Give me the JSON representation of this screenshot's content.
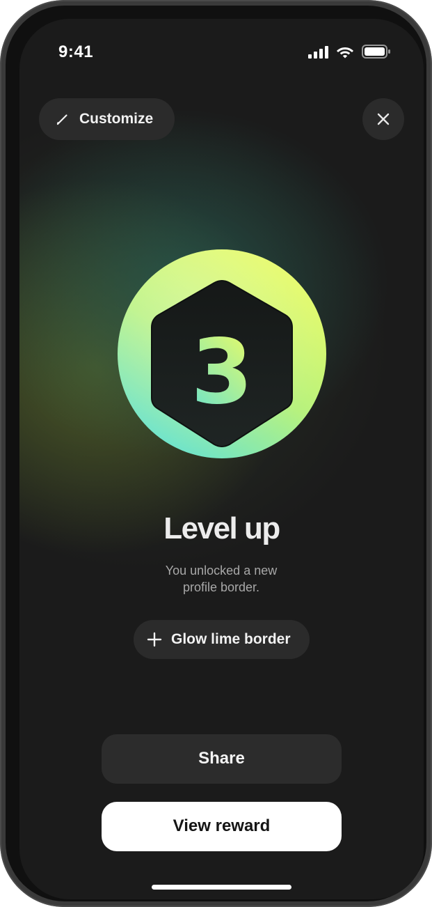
{
  "status_bar": {
    "time": "9:41",
    "icons": [
      "cellular-signal-icon",
      "wifi-icon",
      "battery-icon"
    ]
  },
  "header": {
    "customize_label": "Customize",
    "customize_icon": "pencil-icon",
    "close_icon": "close-icon"
  },
  "badge": {
    "level": "3",
    "shape": "hexagon",
    "colors": {
      "lime": "#E9FB66",
      "mint": "#6CE3CB",
      "inner": "#1F2524"
    }
  },
  "main": {
    "title": "Level up",
    "subtitle": "You unlocked a new profile border.",
    "reward_label": "Glow lime border",
    "reward_icon": "plus-icon"
  },
  "actions": {
    "share_label": "Share",
    "view_reward_label": "View reward"
  },
  "colors": {
    "background": "#1B1B1B",
    "surface": "#2B2B2B",
    "primary_button": "#FFFFFF"
  }
}
